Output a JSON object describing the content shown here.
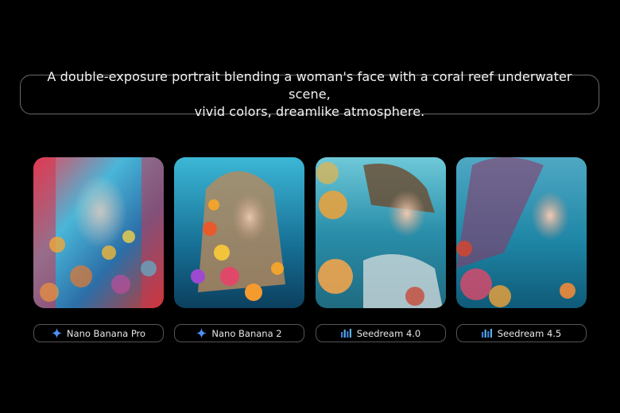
{
  "prompt": {
    "text": "A double-exposure portrait blending a woman's face with a coral reef underwater scene,\nvivid colors, dreamlike atmosphere."
  },
  "results": [
    {
      "model": "Nano Banana Pro",
      "icon": "gemini-sparkle-icon",
      "icon_color": "#4d8ff5"
    },
    {
      "model": "Nano Banana 2",
      "icon": "gemini-sparkle-icon",
      "icon_color": "#4d8ff5"
    },
    {
      "model": "Seedream 4.0",
      "icon": "bar-chart-icon",
      "icon_color": "#3f7ee8"
    },
    {
      "model": "Seedream 4.5",
      "icon": "bar-chart-icon",
      "icon_color": "#3f7ee8"
    }
  ]
}
